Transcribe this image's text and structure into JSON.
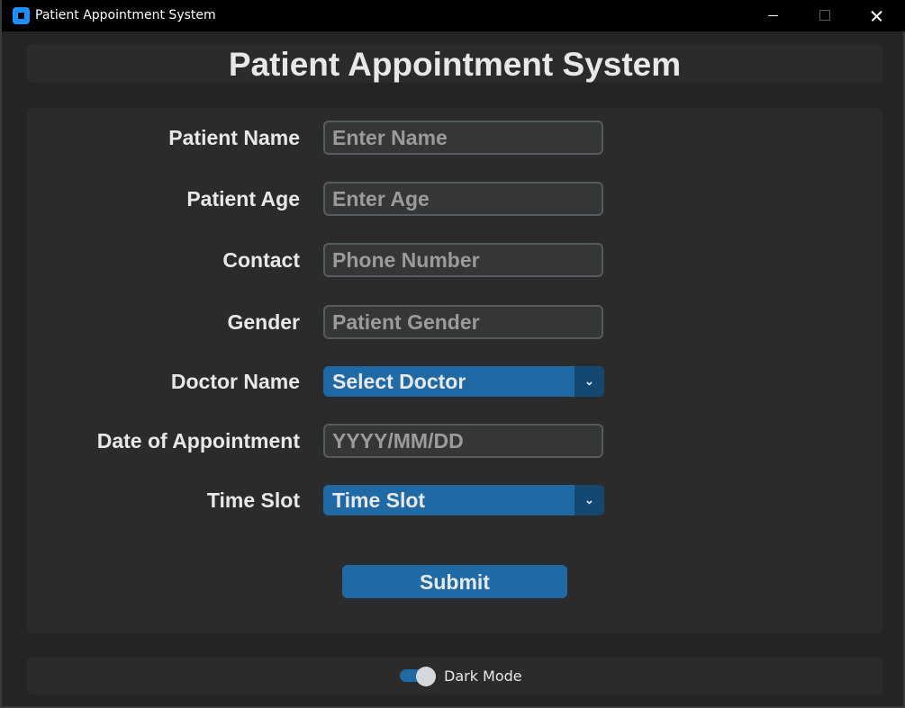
{
  "window": {
    "title": "Patient Appointment System"
  },
  "header": {
    "title": "Patient Appointment System"
  },
  "form": {
    "fields": [
      {
        "label": "Patient Name",
        "value": "",
        "placeholder": "Enter Name"
      },
      {
        "label": "Patient Age",
        "value": "",
        "placeholder": "Enter Age"
      },
      {
        "label": "Contact",
        "value": "",
        "placeholder": "Phone Number"
      },
      {
        "label": "Gender",
        "value": "",
        "placeholder": "Patient Gender"
      },
      {
        "label": "Doctor Name",
        "selected": "Select Doctor"
      },
      {
        "label": "Date of Appointment",
        "value": "",
        "placeholder": "YYYY/MM/DD"
      },
      {
        "label": "Time Slot",
        "selected": "Time Slot"
      }
    ],
    "submit_label": "Submit"
  },
  "footer": {
    "dark_mode_label": "Dark Mode",
    "dark_mode_on": true
  },
  "colors": {
    "accent": "#1f6aa5",
    "accent_dark": "#144870",
    "background": "#242424",
    "frame": "#2b2b2b",
    "entry_bg": "#343638",
    "entry_border": "#565b5e",
    "text": "#e8e8e8",
    "placeholder": "#9b9b9b"
  },
  "icons": {
    "app": "app-icon",
    "minimize": "minimize-icon",
    "maximize": "maximize-icon",
    "close": "close-icon",
    "dropdown": "chevron-down-icon"
  }
}
